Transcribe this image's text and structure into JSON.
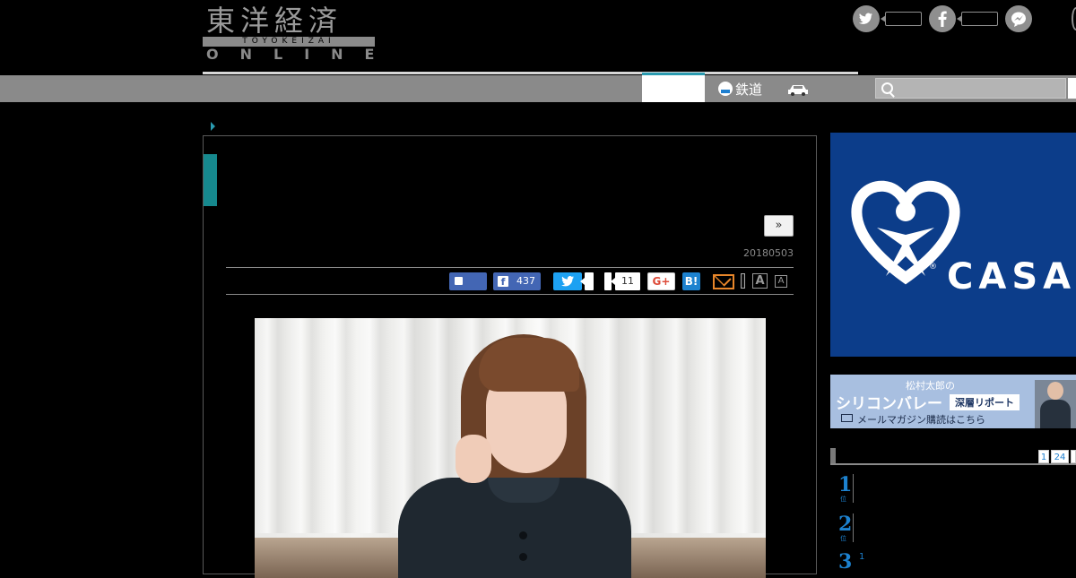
{
  "header": {
    "logo_kanji": "東洋経済",
    "logo_sub": "TOYOKEIZAI",
    "logo_online": "ONLINE"
  },
  "social_top": {
    "twitter_icon": "twitter-icon",
    "facebook_icon": "facebook-icon",
    "messenger_icon": "messenger-icon"
  },
  "nav": {
    "rail_label": "鉄道",
    "search_placeholder": ""
  },
  "article": {
    "next_label": "»",
    "date": "20180503",
    "share": {
      "fb_share_count": "437",
      "pocket_count": "11",
      "gplus_label": "G+",
      "hatena_label": "B!",
      "font_large_label": "A",
      "font_small_label": "A"
    }
  },
  "sidebar": {
    "ad_brand": "CASA",
    "ad_reg": "®",
    "newsletter": {
      "line1": "松村太郎の",
      "line2": "シリコンバレー",
      "tag": "深層リポート",
      "line3": "メールマガジン購読はこちら"
    },
    "ranking": {
      "pages": [
        "1",
        "24"
      ],
      "items": [
        {
          "rank": "1",
          "unit": "位"
        },
        {
          "rank": "2",
          "unit": "位"
        },
        {
          "rank": "3",
          "unit": "",
          "extra": "1"
        }
      ]
    }
  },
  "colors": {
    "accent_teal": "#16898e",
    "nav_gray": "#8a8a8a",
    "facebook": "#4366b4",
    "twitter": "#1da1f2",
    "hatena": "#1d82cf",
    "casa_blue": "#0c3d8a"
  }
}
